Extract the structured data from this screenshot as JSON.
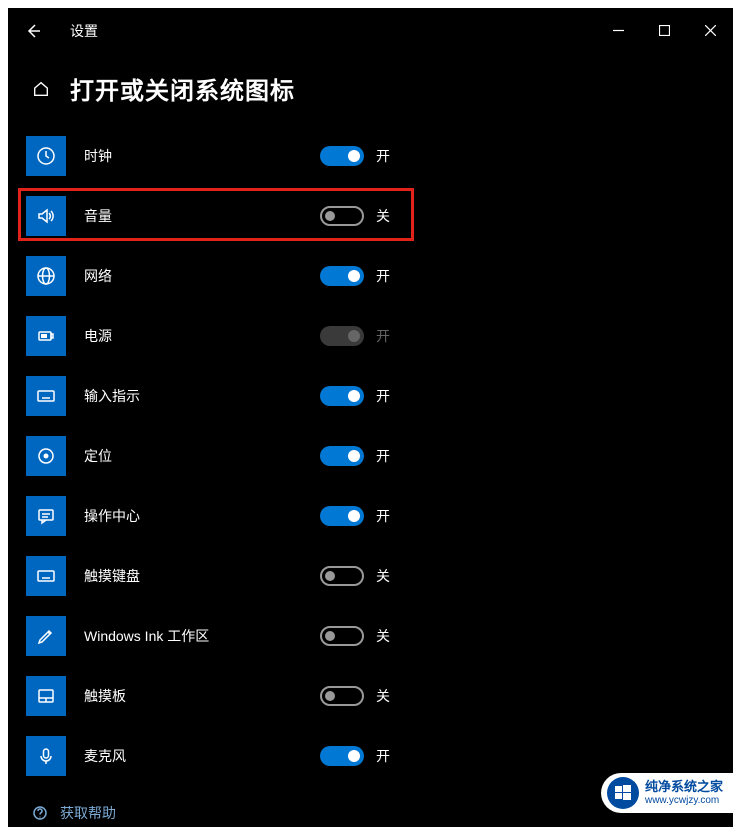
{
  "window": {
    "title": "设置"
  },
  "page": {
    "heading": "打开或关闭系统图标"
  },
  "toggle_states": {
    "on": "开",
    "off": "关"
  },
  "items": [
    {
      "id": "clock",
      "label": "时钟",
      "state": "on",
      "enabled": true,
      "icon": "clock"
    },
    {
      "id": "volume",
      "label": "音量",
      "state": "off",
      "enabled": true,
      "icon": "volume",
      "highlighted": true
    },
    {
      "id": "network",
      "label": "网络",
      "state": "on",
      "enabled": true,
      "icon": "globe"
    },
    {
      "id": "power",
      "label": "电源",
      "state": "on",
      "enabled": false,
      "icon": "battery"
    },
    {
      "id": "ime",
      "label": "输入指示",
      "state": "on",
      "enabled": true,
      "icon": "keyboard"
    },
    {
      "id": "location",
      "label": "定位",
      "state": "on",
      "enabled": true,
      "icon": "target"
    },
    {
      "id": "action-center",
      "label": "操作中心",
      "state": "on",
      "enabled": true,
      "icon": "chat"
    },
    {
      "id": "touch-keyboard",
      "label": "触摸键盘",
      "state": "off",
      "enabled": true,
      "icon": "keyboard"
    },
    {
      "id": "windows-ink",
      "label": "Windows Ink 工作区",
      "state": "off",
      "enabled": true,
      "icon": "pen"
    },
    {
      "id": "touchpad",
      "label": "触摸板",
      "state": "off",
      "enabled": true,
      "icon": "touchpad"
    },
    {
      "id": "microphone",
      "label": "麦克风",
      "state": "on",
      "enabled": true,
      "icon": "mic"
    }
  ],
  "help": {
    "label": "获取帮助"
  },
  "watermark": {
    "line1": "纯净系统之家",
    "line2": "www.ycwjzy.com"
  }
}
